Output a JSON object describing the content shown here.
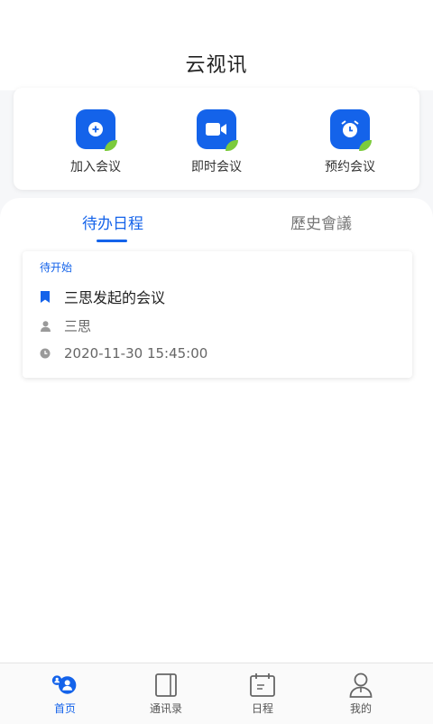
{
  "header": {
    "title": "云视讯"
  },
  "actions": [
    {
      "label": "加入会议",
      "icon": "join-meeting-icon"
    },
    {
      "label": "即时会议",
      "icon": "video-camera-icon"
    },
    {
      "label": "预约会议",
      "icon": "alarm-clock-icon"
    }
  ],
  "tabs": [
    {
      "label": "待办日程",
      "active": true
    },
    {
      "label": "歷史會議",
      "active": false
    }
  ],
  "schedule": {
    "status": "待开始",
    "title": "三思发起的会议",
    "host": "三思",
    "datetime": "2020-11-30 15:45:00"
  },
  "tabbar": [
    {
      "label": "首页",
      "icon": "home-people-icon",
      "active": true
    },
    {
      "label": "通讯录",
      "icon": "contacts-book-icon",
      "active": false
    },
    {
      "label": "日程",
      "icon": "calendar-icon",
      "active": false
    },
    {
      "label": "我的",
      "icon": "profile-icon",
      "active": false
    }
  ],
  "colors": {
    "accent": "#1463ea",
    "leaf": "#7ccb3c"
  }
}
